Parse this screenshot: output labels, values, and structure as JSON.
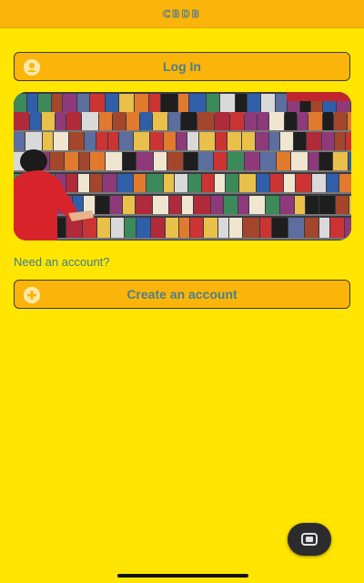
{
  "header": {
    "title": "CBDB"
  },
  "login": {
    "label": "Log In",
    "icon": "user-icon"
  },
  "hero": {
    "description_icon": "comic-store-photo"
  },
  "signup_prompt": "Need an account?",
  "create": {
    "label": "Create an account",
    "icon": "plus-icon"
  },
  "fab": {
    "icon": "square-icon"
  },
  "colors": {
    "background": "#FFE500",
    "accent": "#FBB40A",
    "text": "#4C7F8C"
  }
}
